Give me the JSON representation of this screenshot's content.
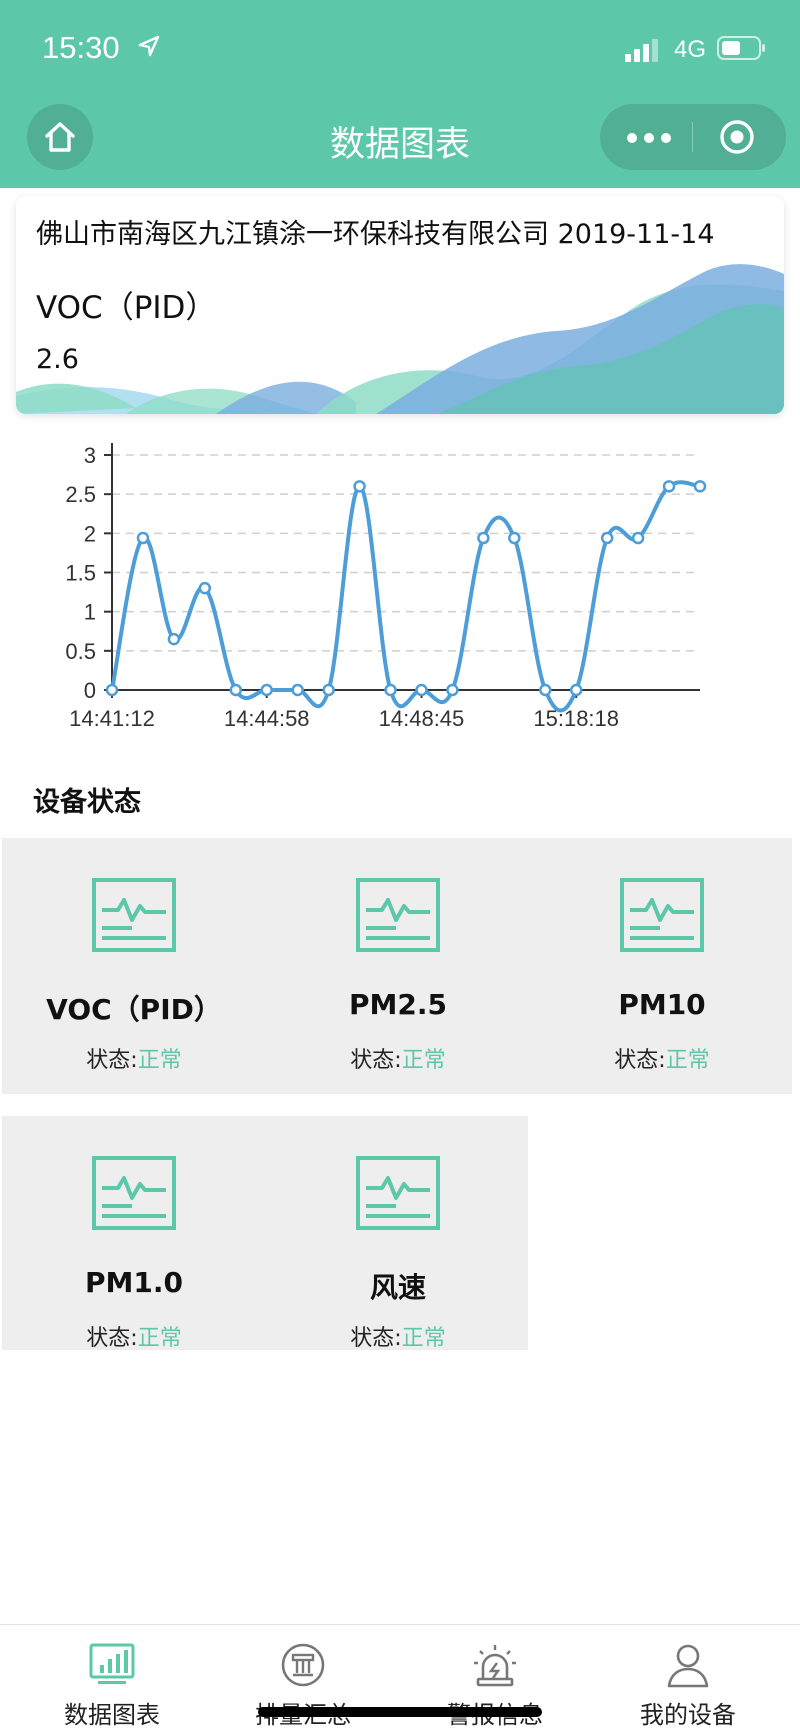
{
  "status_bar": {
    "time": "15:30",
    "network": "4G"
  },
  "header": {
    "title": "数据图表"
  },
  "summary": {
    "company": "佛山市南海区九江镇涂一环保科技有限公司 2019-11-14",
    "metric_name": "VOC（PID）",
    "metric_value": "2.6"
  },
  "colors": {
    "accent": "#5cc8a9",
    "line": "#4d9ed8"
  },
  "chart_data": {
    "type": "line",
    "x": [
      "14:41:12",
      "",
      "",
      "",
      "14:44:58",
      "",
      "",
      "",
      "",
      "14:48:45",
      "",
      "",
      "",
      "",
      "15:18:18",
      "",
      "",
      "",
      ""
    ],
    "values": [
      0,
      1.94,
      0.65,
      1.3,
      0,
      0,
      0,
      0,
      2.6,
      0,
      0,
      0,
      1.94,
      1.94,
      0,
      0,
      1.94,
      1.94,
      2.6,
      2.6
    ],
    "x_tick_labels": [
      "14:41:12",
      "14:44:58",
      "14:48:45",
      "15:18:18"
    ],
    "y_ticks": [
      "0",
      "0.5",
      "1",
      "1.5",
      "2",
      "2.5",
      "3"
    ],
    "ylim": [
      0,
      3
    ],
    "grid": true,
    "smooth": true
  },
  "devices_section": {
    "title": "设备状态"
  },
  "devices": [
    {
      "name": "VOC（PID）",
      "state_label": "状态:",
      "state_value": "正常"
    },
    {
      "name": "PM2.5",
      "state_label": "状态:",
      "state_value": "正常"
    },
    {
      "name": "PM10",
      "state_label": "状态:",
      "state_value": "正常"
    },
    {
      "name": "PM1.0",
      "state_label": "状态:",
      "state_value": "正常"
    },
    {
      "name": "风速",
      "state_label": "状态:",
      "state_value": "正常"
    }
  ],
  "tabbar": [
    {
      "label": "数据图表",
      "icon": "bar-chart-icon"
    },
    {
      "label": "排量汇总",
      "icon": "emission-icon"
    },
    {
      "label": "警报信息",
      "icon": "alarm-icon"
    },
    {
      "label": "我的设备",
      "icon": "user-icon"
    }
  ]
}
